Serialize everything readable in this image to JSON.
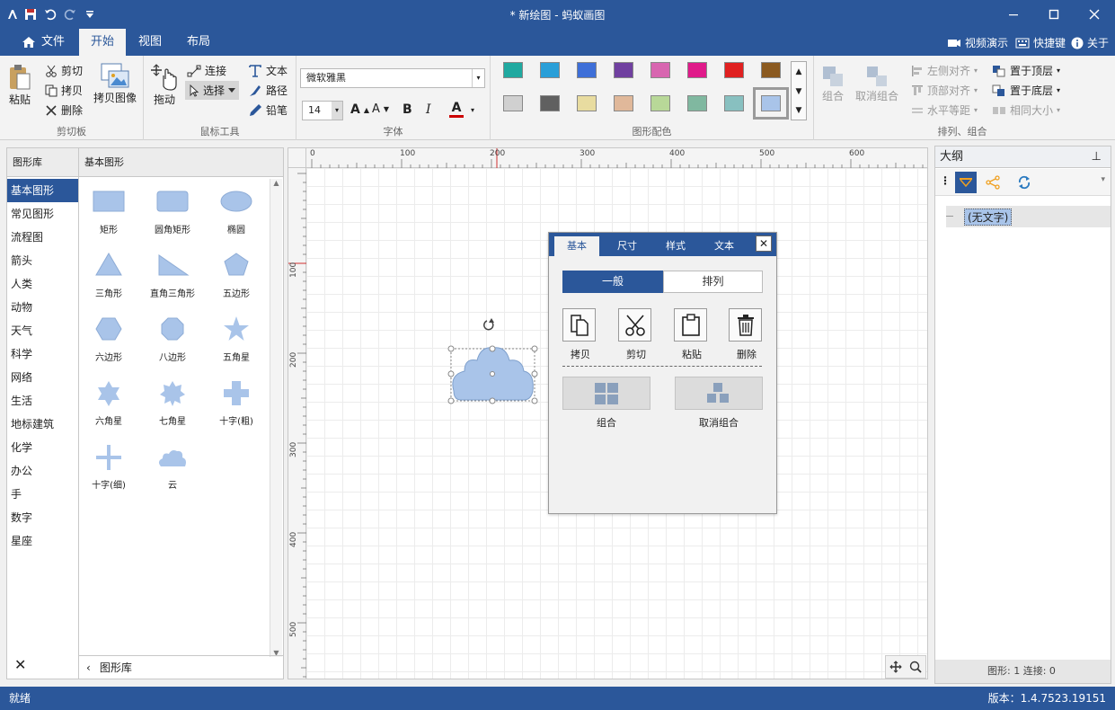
{
  "window": {
    "title": "* 新绘图 - 蚂蚁画图"
  },
  "tabs": {
    "file": "文件",
    "home": "开始",
    "view": "视图",
    "layout": "布局"
  },
  "topright": {
    "video": "视频演示",
    "shortcuts": "快捷键",
    "about": "关于"
  },
  "ribbon": {
    "clipboard": {
      "title": "剪切板",
      "paste": "粘贴",
      "cut": "剪切",
      "copy": "拷贝",
      "delete": "删除",
      "copy_image": "拷贝图像"
    },
    "mouse": {
      "title": "鼠标工具",
      "drag": "拖动",
      "connect": "连接",
      "select": "选择",
      "text": "文本",
      "path": "路径",
      "pencil": "铅笔"
    },
    "font": {
      "title": "字体",
      "family": "微软雅黑",
      "size": "14",
      "bold": "B",
      "italic": "I",
      "color_letter": "A",
      "grow": "A",
      "shrink": "A"
    },
    "colors": {
      "title": "图形配色",
      "row1": [
        "#20a9a0",
        "#2a9fd8",
        "#3e6fd8",
        "#7040a0",
        "#d866b0",
        "#e01a8a",
        "#e02020",
        "#8b5a20"
      ],
      "row2": [
        "#d0d0d0",
        "#606060",
        "#e8dca0",
        "#e0b89a",
        "#b8d898",
        "#80b8a0",
        "#88c0c0",
        "#a9c4e9"
      ]
    },
    "arrange": {
      "title": "排列、组合",
      "group": "组合",
      "ungroup": "取消组合",
      "align_left": "左侧对齐",
      "align_top": "顶部对齐",
      "h_spacing": "水平等距",
      "bring_front": "置于顶层",
      "send_back": "置于底层",
      "same_size": "相同大小"
    }
  },
  "library": {
    "header_left": "图形库",
    "header_right": "基本图形",
    "categories": [
      "基本图形",
      "常见图形",
      "流程图",
      "箭头",
      "人类",
      "动物",
      "天气",
      "科学",
      "网络",
      "生活",
      "地标建筑",
      "化学",
      "办公",
      "手",
      "数字",
      "星座"
    ],
    "shapes": [
      "矩形",
      "圆角矩形",
      "椭圆",
      "三角形",
      "直角三角形",
      "五边形",
      "六边形",
      "八边形",
      "五角星",
      "六角星",
      "七角星",
      "十字(粗)",
      "十字(细)",
      "云"
    ],
    "footer": "图形库"
  },
  "ruler": {
    "h_labels": [
      "0",
      "100",
      "200",
      "300",
      "400",
      "500",
      "600"
    ],
    "v_labels": [
      "100",
      "200",
      "300",
      "400",
      "500"
    ]
  },
  "popup": {
    "tabs": [
      "基本",
      "尺寸",
      "样式",
      "文本"
    ],
    "seg_general": "一般",
    "seg_arrange": "排列",
    "copy": "拷贝",
    "cut": "剪切",
    "paste": "粘贴",
    "delete": "删除",
    "group": "组合",
    "ungroup": "取消组合"
  },
  "outline": {
    "title": "大纲",
    "item": "(无文字)",
    "footer": "图形: 1   连接: 0"
  },
  "status": {
    "left": "就绪",
    "right": "版本：1.4.7523.19151"
  },
  "theme": {
    "primary": "#2b579a",
    "shape_fill": "#a9c4e9"
  }
}
